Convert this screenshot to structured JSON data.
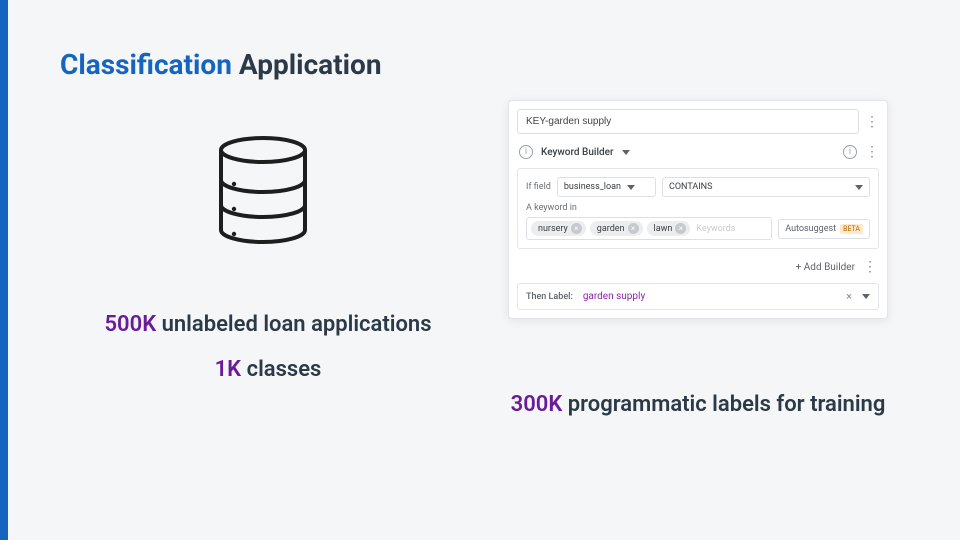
{
  "title": {
    "highlighted": "Classification",
    "rest": "Application"
  },
  "left": {
    "count": "500K",
    "count_label": "unlabeled loan applications",
    "classes": "1K",
    "classes_label": "classes"
  },
  "right": {
    "count": "300K",
    "count_label": "programmatic labels for training"
  },
  "panel": {
    "name_value": "KEY-garden supply",
    "builder_title": "Keyword Builder",
    "if_label": "If field",
    "field": "business_loan",
    "operator": "CONTAINS",
    "keyword_in_label": "A keyword in",
    "tags": {
      "0": "nursery",
      "1": "garden",
      "2": "lawn"
    },
    "keywords_placeholder": "Keywords",
    "autosuggest": "Autosuggest",
    "beta": "BETA",
    "add_builder": "+ Add Builder",
    "then_label": "Then Label:",
    "then_value": "garden supply"
  }
}
